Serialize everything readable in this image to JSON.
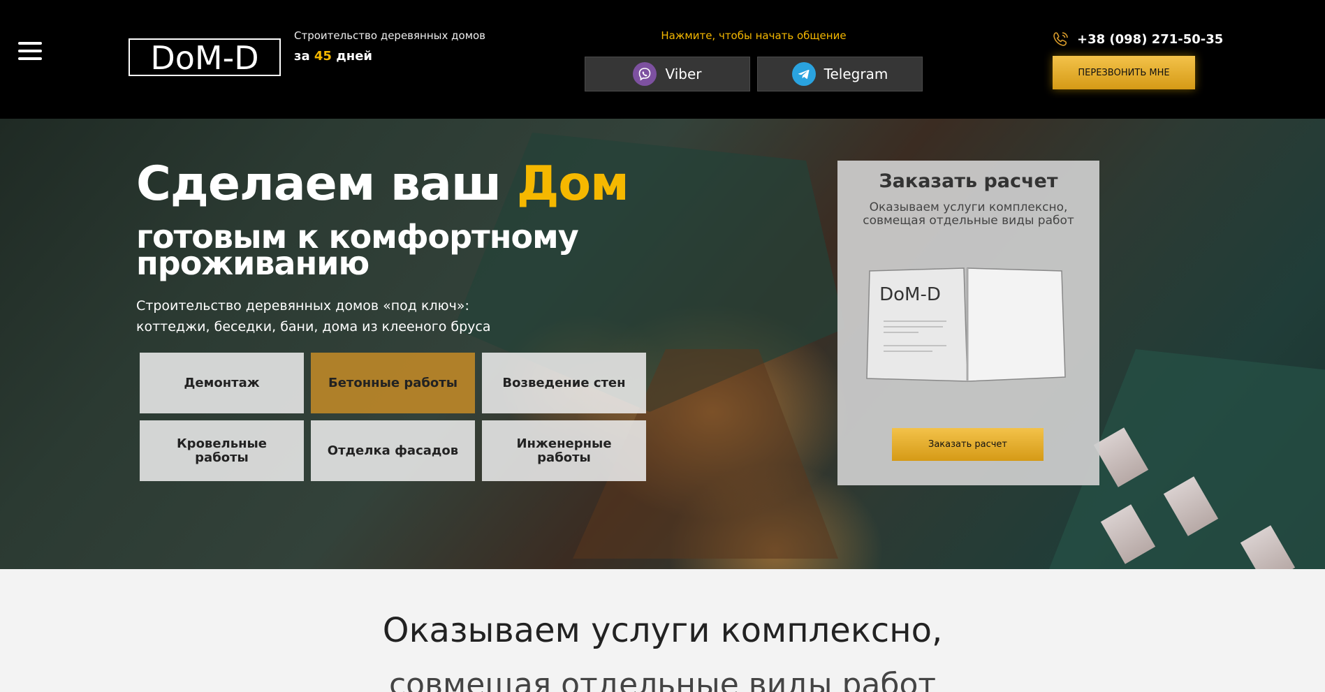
{
  "header": {
    "menu_icon": "hamburger-icon",
    "logo_text": "DoM-D",
    "tagline_line1": "Строительство деревянных домов",
    "tagline_prefix": "за",
    "tagline_days": "45",
    "tagline_suffix": "дней",
    "chat_hint": "Нажмите, чтобы начать общение",
    "viber_label": "Viber",
    "telegram_label": "Telegram",
    "phone": "+38 (098) 271-50-35",
    "callback_label": "ПЕРЕЗВОНИТЬ МНЕ"
  },
  "hero": {
    "title_main": "Сделаем ваш",
    "title_accent": "Дом",
    "subtitle": "готовым к комфортному проживанию",
    "description": "Строительство деревянных домов «под ключ»: коттеджи, беседки, бани, дома из клееного бруса",
    "services": [
      {
        "label": "Демонтаж"
      },
      {
        "label": "Бетонные работы"
      },
      {
        "label": "Возведение стен"
      },
      {
        "label": "Кровельные работы"
      },
      {
        "label": "Отделка фасадов"
      },
      {
        "label": "Инженерные работы"
      }
    ]
  },
  "order_card": {
    "title": "Заказать расчет",
    "subtitle": "Оказываем услуги комплексно, совмещая отдельные виды работ",
    "book_logo": "DoM-D",
    "button_label": "Заказать расчет"
  },
  "section": {
    "heading_line1": "Оказываем услуги комплексно,",
    "heading_line2": "совмещая отдельные виды работ"
  },
  "colors": {
    "accent": "#f5b800",
    "header_bg": "#000000",
    "messenger_bg": "#363636",
    "viber": "#7d51a0",
    "telegram": "#2aa3df"
  }
}
